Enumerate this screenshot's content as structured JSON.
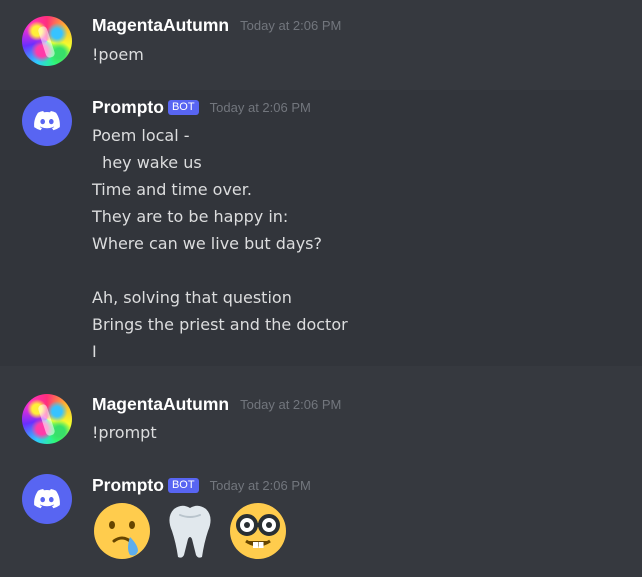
{
  "messages": [
    {
      "author": "MagentaAutumn",
      "timestamp": "Today at 2:06 PM",
      "text": "!poem"
    },
    {
      "author": "Prompto",
      "bot_tag": "BOT",
      "timestamp": "Today at 2:06 PM",
      "lines": [
        "Poem local -",
        "  hey wake us",
        "Time and time over.",
        "They are to be happy in:",
        "Where can we live but days?",
        "",
        "Ah, solving that question",
        "Brings the priest and the doctor",
        "I"
      ]
    },
    {
      "author": "MagentaAutumn",
      "timestamp": "Today at 2:06 PM",
      "text": "!prompt"
    },
    {
      "author": "Prompto",
      "bot_tag": "BOT",
      "timestamp": "Today at 2:06 PM",
      "emojis": [
        "crying-face-emoji",
        "tooth-emoji",
        "nerd-face-emoji"
      ]
    }
  ],
  "colors": {
    "background": "#36393f",
    "hover_background": "#32353b",
    "blurple": "#5865f2",
    "username": "#ffffff",
    "text": "#dcddde",
    "timestamp": "#72767d"
  }
}
